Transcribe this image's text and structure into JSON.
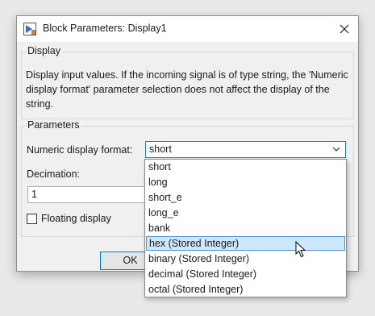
{
  "window": {
    "title": "Block Parameters: Display1"
  },
  "display_group": {
    "label": "Display",
    "description": "Display input values. If the incoming signal is of type string, the 'Numeric display format' parameter selection does not affect the display of the string."
  },
  "parameters_group": {
    "label": "Parameters",
    "numeric_format_label": "Numeric display format:",
    "numeric_format_value": "short",
    "decimation_label": "Decimation:",
    "decimation_value": "1",
    "floating_display_label": "Floating display",
    "floating_display_checked": false
  },
  "buttons": {
    "ok_label": "OK"
  },
  "dropdown": {
    "options": [
      "short",
      "long",
      "short_e",
      "long_e",
      "bank",
      "hex (Stored Integer)",
      "binary (Stored Integer)",
      "decimal (Stored Integer)",
      "octal (Stored Integer)"
    ],
    "highlighted_index": 5
  },
  "colors": {
    "accent": "#0078d7",
    "highlight": "#cce8ff",
    "highlight_border": "#4a8fd0"
  }
}
